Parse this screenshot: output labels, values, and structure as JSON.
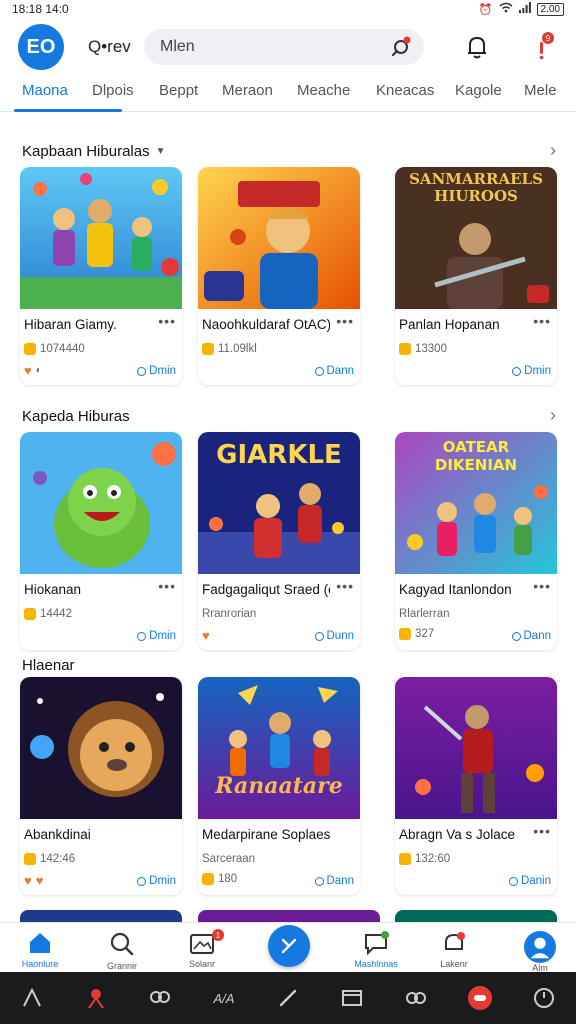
{
  "status_bar": {
    "time": "18:18 14:0",
    "battery": "2.00"
  },
  "header": {
    "logo_text": "EO",
    "app_name": "Q•rev",
    "search_value": "Mlen",
    "notif_badge": "9"
  },
  "tabs": [
    {
      "label": "Maona",
      "active": true
    },
    {
      "label": "Dlpois"
    },
    {
      "label": "Beppt"
    },
    {
      "label": "Meraon"
    },
    {
      "label": "Meache"
    },
    {
      "label": "Kneacas"
    },
    {
      "label": "Kagole"
    },
    {
      "label": "Mele"
    }
  ],
  "sections": [
    {
      "title": "Kapbaan Hiburalas",
      "cards": [
        {
          "title": "Hibaran Giamy.",
          "stat": "1074440",
          "open": "Dmin",
          "theme": "kids"
        },
        {
          "title": "Naoohkuldaraf OtAC)",
          "stat": "11.09lkl",
          "open": "Dann",
          "theme": "boy"
        },
        {
          "title": "Panlan Hopanan",
          "stat": "13300",
          "open": "Dmin",
          "theme": "dark",
          "art_text": "SANMARRAELS HIUROOS"
        }
      ]
    },
    {
      "title": "Kapeda Hiburas",
      "cards": [
        {
          "title": "Hiokanan",
          "stat": "14442",
          "open": "Dmin",
          "theme": "monster"
        },
        {
          "title": "Fadgagaliqut Sraed (olanly",
          "sub": "Rranrorian",
          "open": "Dunn",
          "theme": "giarkle",
          "art_text": "GIARKLE"
        },
        {
          "title": "Kagyad Itanlondon",
          "sub": "Rlarlerran",
          "stat": "327",
          "open": "Dann",
          "theme": "oatear",
          "art_text": "OATEAR DIKENIAN"
        }
      ]
    },
    {
      "title": "Hlaenar",
      "cards": [
        {
          "title": "Abankdinai",
          "stat": "142:46",
          "open": "Dmin",
          "theme": "lion"
        },
        {
          "title": "Medarpirane Soplaesl",
          "sub": "Sarceraan",
          "stat": "180",
          "open": "Dann",
          "theme": "rana",
          "art_text": "Ranaatare"
        },
        {
          "title": "Abragn Va s Jolace",
          "stat": "132:60",
          "open": "Danin",
          "theme": "warrior"
        }
      ]
    }
  ],
  "bottom_nav": [
    {
      "label": "Haonlure",
      "icon": "home-icon",
      "active": true
    },
    {
      "label": "Grannir",
      "icon": "search-icon"
    },
    {
      "label": "Solanr",
      "icon": "gallery-icon",
      "badge": "1"
    },
    {
      "label": "Mashlnnas",
      "icon": "chat-icon"
    },
    {
      "label": "Lakenr",
      "icon": "bell-icon"
    },
    {
      "label": "Alm",
      "icon": "profile-icon"
    }
  ],
  "colors": {
    "accent": "#1479e0",
    "badge": "#e53935",
    "coin": "#f4b400"
  }
}
